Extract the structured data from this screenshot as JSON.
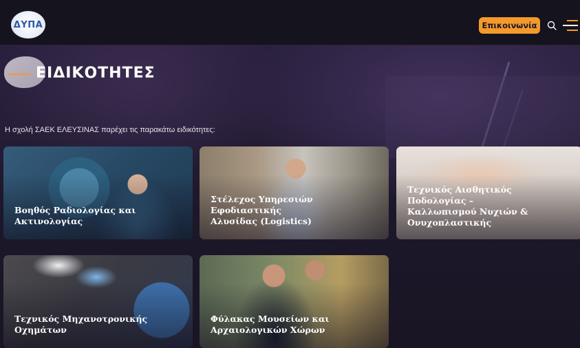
{
  "header": {
    "logo_text": "ΔΥΠΑ",
    "contact_label": "Επικοινωνία",
    "icons": [
      "search-icon",
      "menu-icon"
    ],
    "accent_color": "#f39a2b"
  },
  "page": {
    "title": "ΕΙΔΙΚΟΤΗΤΕΣ",
    "intro": "Η σχολή ΣΑΕΚ ΕΛΕΥΣΙΝΑΣ παρέχει τις παρακάτω ειδικότητες:"
  },
  "specialties": [
    {
      "line1": "Βοηθός Ραδιολογίας και Ακτινολογίας",
      "line2": "",
      "line3": ""
    },
    {
      "line1": "Στέλεχος Υπηρεσιών Εφοδιαστικής",
      "line2": "Αλυσίδας (Logistics)",
      "line3": ""
    },
    {
      "line1": "Τεχνικός Αισθητικός Ποδολογίας –",
      "line2": "Καλλωπισμού Νυχιών &",
      "line3": "Ονυχοπλαστικής"
    },
    {
      "line1": "Τεχνικός Μηχανοτρονικής Οχημάτων",
      "line2": "",
      "line3": ""
    },
    {
      "line1": "Φύλακας Μουσείων και",
      "line2": "Αρχαιολογικών Χώρων",
      "line3": ""
    }
  ]
}
